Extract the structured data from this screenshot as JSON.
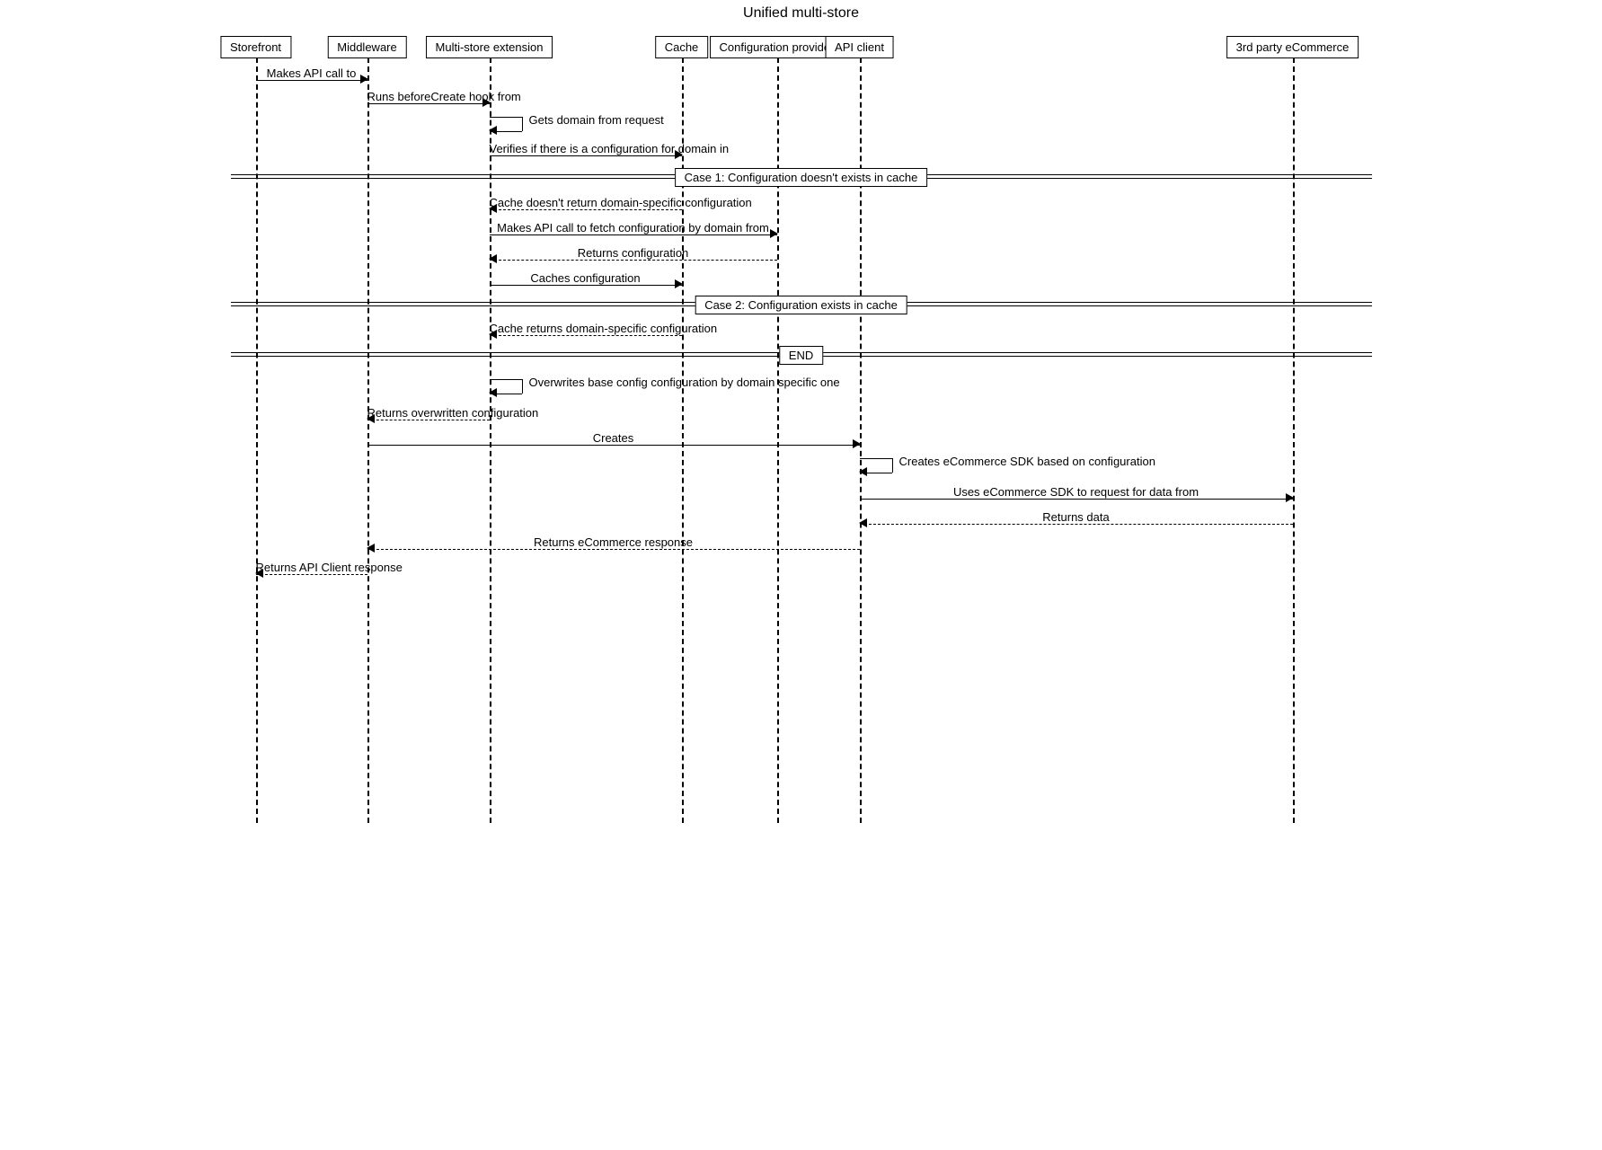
{
  "title": "Unified multi-store",
  "participants": {
    "p0": "Storefront",
    "p1": "Middleware",
    "p2": "Multi-store extension",
    "p3": "Cache",
    "p4": "Configuration provider",
    "p5": "API client",
    "p6": "3rd party eCommerce"
  },
  "messages": {
    "m1": "Makes API call to",
    "m2": "Runs beforeCreate hook from",
    "m3": "Gets domain from request",
    "m4": "Verifies if there is a configuration for domain in",
    "m5": "Cache doesn't return domain-specific configuration",
    "m6": "Makes API call to fetch configuration by domain from",
    "m7": "Returns configuration",
    "m8": "Caches configuration",
    "m9": "Cache returns domain-specific configuration",
    "m10": "Overwrites base config configuration by domain specific one",
    "m11": "Returns overwritten configuration",
    "m12": "Creates",
    "m13": "Creates eCommerce SDK based on configuration",
    "m14": "Uses eCommerce SDK to request for data from",
    "m15": "Returns data",
    "m16": "Returns eCommerce response",
    "m17": "Returns API Client response"
  },
  "dividers": {
    "d1": "Case 1: Configuration doesn't exists in cache",
    "d2": "Case 2: Configuration exists in cache",
    "d3": "END"
  }
}
